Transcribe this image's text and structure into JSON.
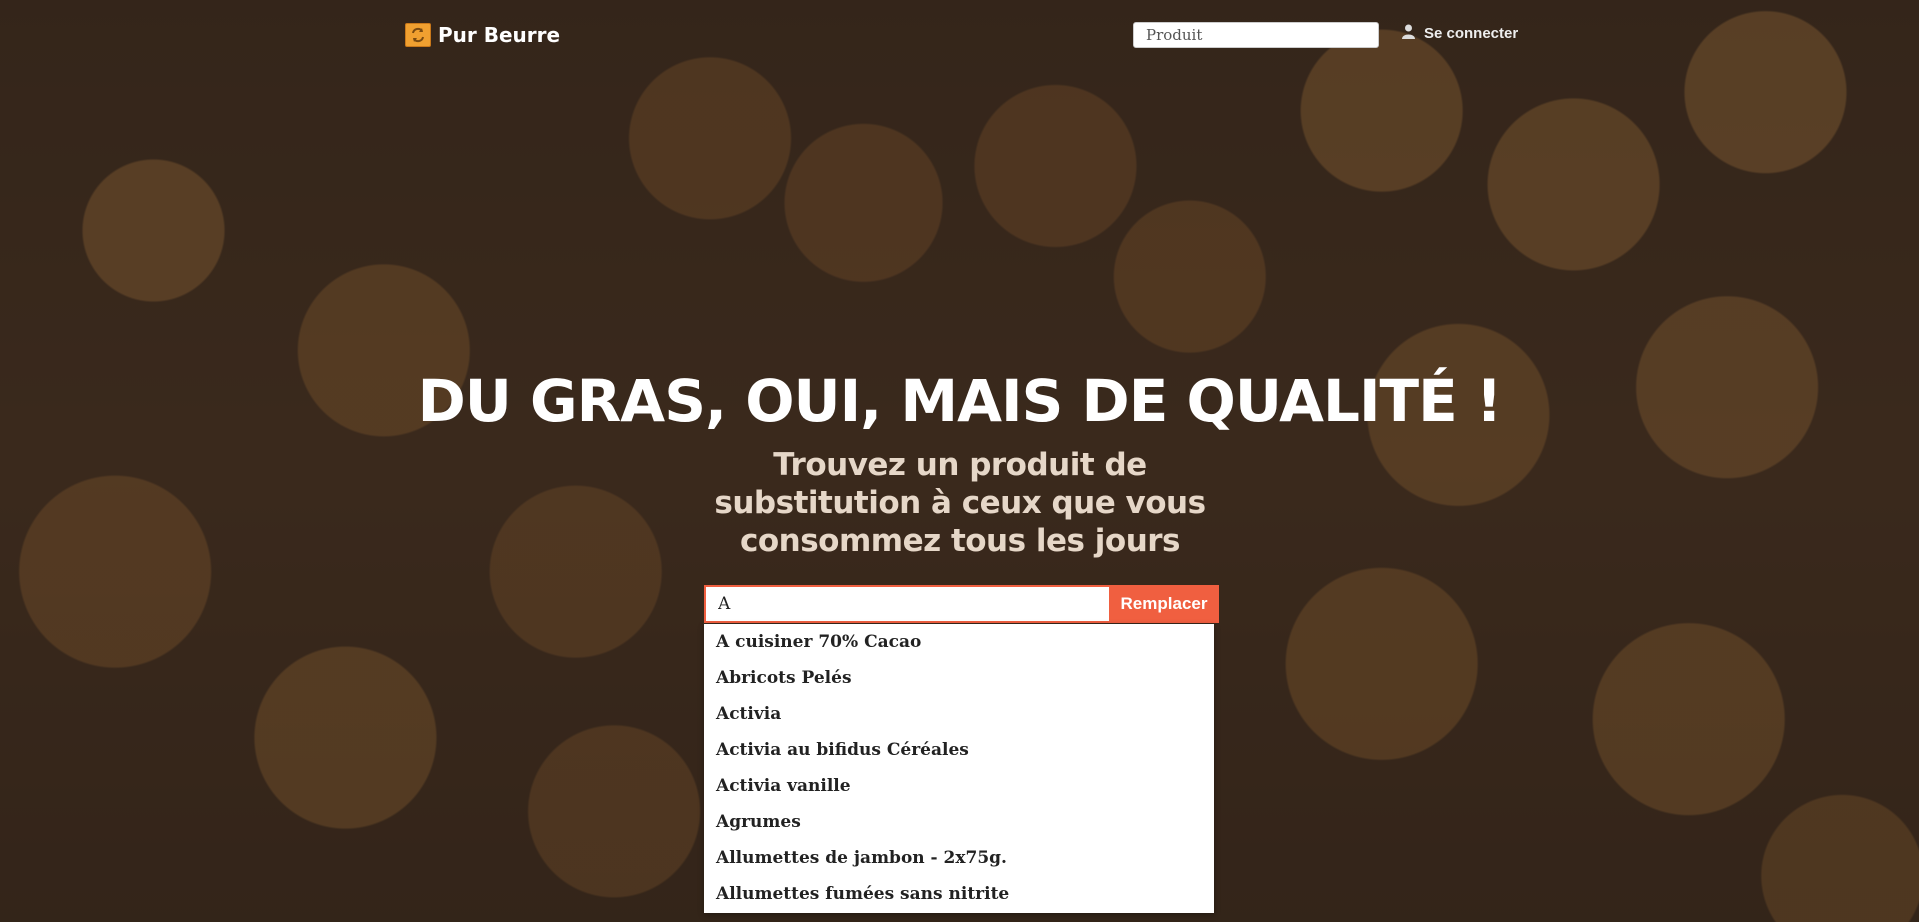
{
  "nav": {
    "brand": "Pur Beurre",
    "search_placeholder": "Produit",
    "login_label": "Se connecter"
  },
  "hero": {
    "title": "DU GRAS, OUI, MAIS DE QUALITÉ !",
    "subtitle": "Trouvez un produit de substitution à ceux que vous consommez tous les jours"
  },
  "search": {
    "value": "A",
    "button_label": "Remplacer",
    "suggestions": [
      "A cuisiner 70% Cacao",
      "Abricots Pelés",
      "Activia",
      "Activia au bifidus Céréales",
      "Activia vanille",
      "Agrumes",
      "Allumettes de jambon - 2x75g.",
      "Allumettes fumées sans nitrite"
    ]
  },
  "colors": {
    "accent": "#f05f40",
    "logo": "#f0a030"
  },
  "icons": {
    "brand": "refresh-arrows-icon",
    "login": "user-icon"
  }
}
